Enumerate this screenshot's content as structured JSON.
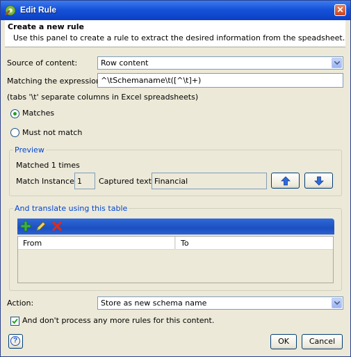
{
  "window": {
    "title": "Edit Rule",
    "close_glyph": "✕"
  },
  "header": {
    "title": "Create a new rule",
    "description": "Use this panel to create a rule to extract the desired information from the speadsheet."
  },
  "source": {
    "label": "Source of content:",
    "value": "Row content"
  },
  "matching": {
    "label": "Matching the expression:",
    "value": "^\\tSchemaname\\t([^\\t]+)",
    "note": "(tabs '\\t' separate columns in Excel spreadsheets)"
  },
  "match_options": {
    "matches_label": "Matches",
    "must_not_match_label": "Must not match",
    "selected": "Matches"
  },
  "preview": {
    "title": "Preview",
    "matched_text": "Matched 1 times",
    "instance_label": "Match Instance:",
    "instance_value": "1",
    "captured_label": "Captured text:",
    "captured_value": "Financial",
    "up_icon": "arrow-up-icon",
    "down_icon": "arrow-down-icon"
  },
  "translate": {
    "title": "And translate using this table",
    "toolbar_icons": [
      "add-icon",
      "edit-icon",
      "delete-icon"
    ],
    "columns": [
      "From",
      "To"
    ],
    "rows": []
  },
  "action": {
    "label": "Action:",
    "value": "Store as new schema name"
  },
  "stop_processing": {
    "label": "And don't process any more rules for this content.",
    "checked": true
  },
  "buttons": {
    "ok": "OK",
    "cancel": "Cancel",
    "help_glyph": "?"
  },
  "colors": {
    "title_bar": "#1652d8",
    "group_title": "#0046d5",
    "toolbar": "#1c4fc0"
  }
}
